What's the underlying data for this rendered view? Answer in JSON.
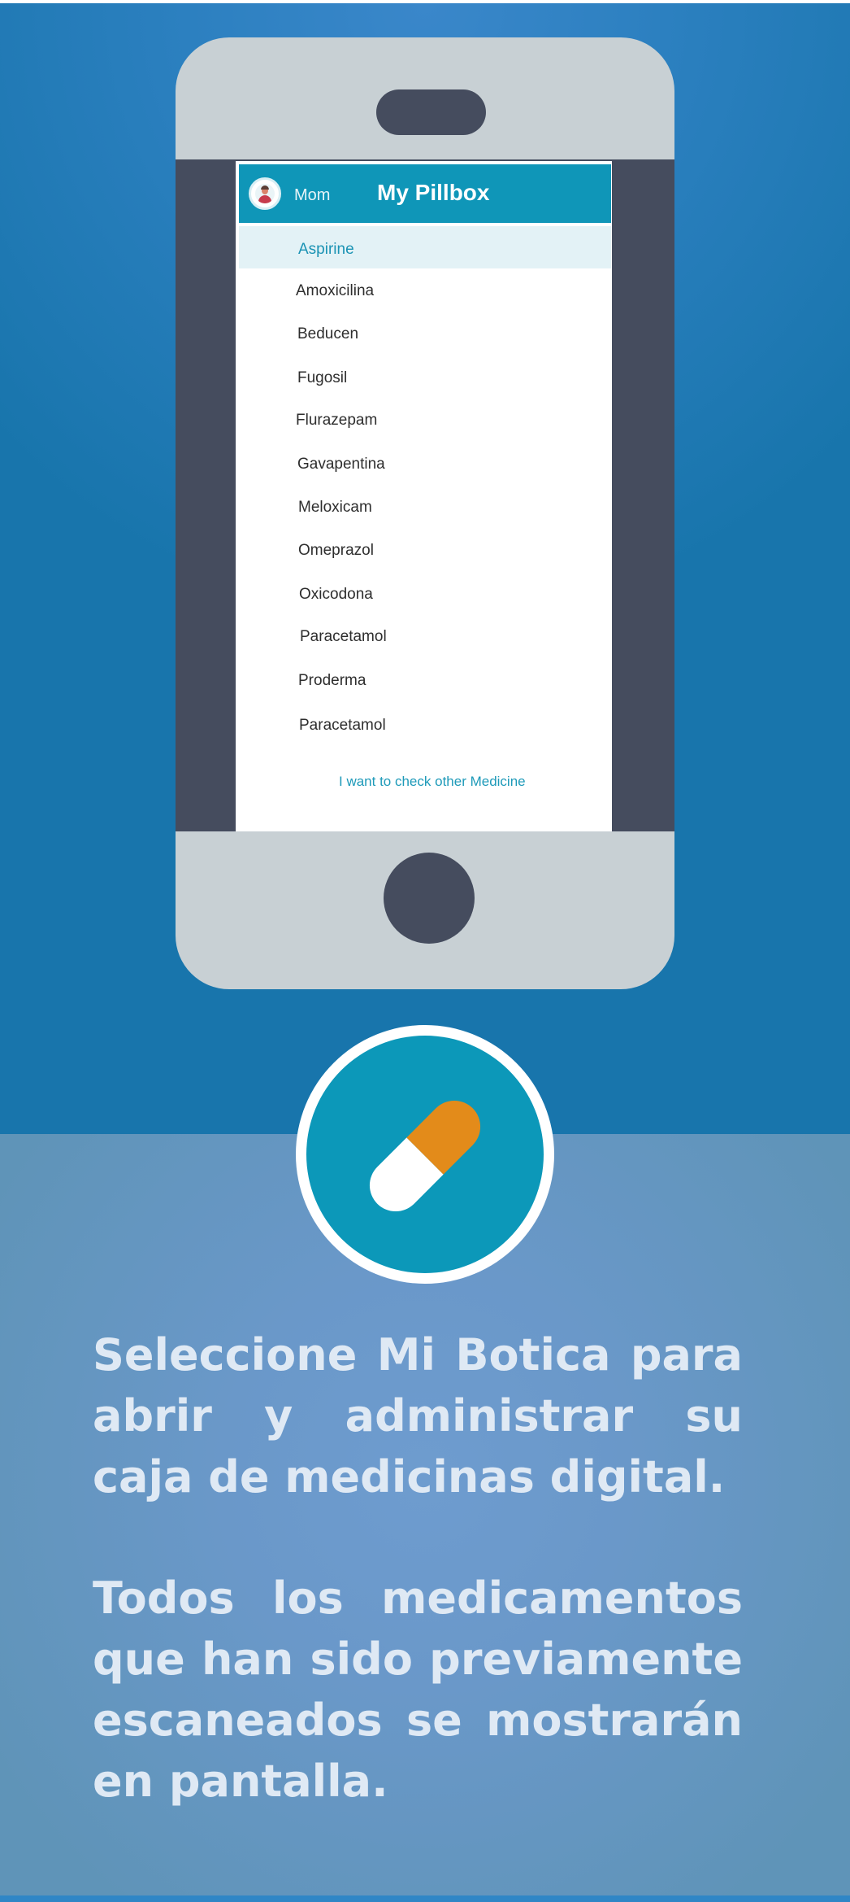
{
  "app": {
    "profile_name": "Mom",
    "title": "My Pillbox",
    "medicines": [
      "Aspirine",
      "Amoxicilina",
      "Beducen",
      "Fugosil",
      "Flurazepam",
      "Gavapentina",
      "Meloxicam",
      "Omeprazol",
      "Oxicodona",
      "Paracetamol",
      "Proderma",
      "Paracetamol"
    ],
    "selected_index": 0,
    "check_other_link": "I want to check other Medicine"
  },
  "info": {
    "paragraph_1": "Seleccione Mi Botica para abrir y administrar su caja de medicinas digital.",
    "paragraph_2": "Todos los medicamentos que han sido previamente escaneados se mostrarán en pantalla."
  },
  "icons": {
    "badge": "pill-capsule-icon",
    "avatar": "user-avatar-icon"
  },
  "colors": {
    "header": "#0f96b8",
    "accent": "#1b93b4",
    "capsule_orange": "#e38b1a",
    "background_top": "#1f7db5",
    "background_bottom": "#6a98c9",
    "phone_frame": "#c8d0d4",
    "phone_dark": "#454c5e"
  }
}
